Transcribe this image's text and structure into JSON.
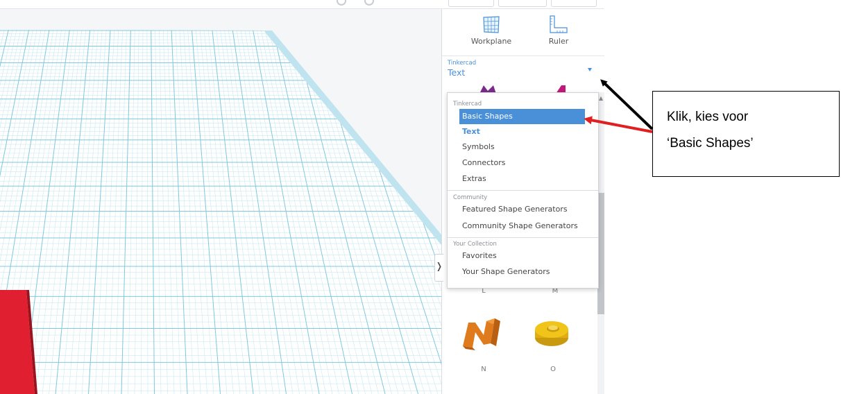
{
  "toolbar": {
    "workplane_label": "Workplane",
    "ruler_label": "Ruler",
    "workplane_icon": "workplane-icon",
    "ruler_icon": "ruler-icon"
  },
  "library_select": {
    "group": "Tinkercad",
    "value": "Text",
    "caret_icon": "chevron-down-icon"
  },
  "menu": {
    "sections": [
      {
        "title": "Tinkercad",
        "items": [
          "Basic Shapes",
          "Text",
          "Symbols",
          "Connectors",
          "Extras"
        ]
      },
      {
        "title": "Community",
        "items": [
          "Featured Shape Generators",
          "Community Shape Generators"
        ]
      },
      {
        "title": "Your Collection",
        "items": [
          "Favorites",
          "Your Shape Generators"
        ]
      }
    ],
    "highlighted": "Basic Shapes",
    "current": "Text"
  },
  "shapes": [
    {
      "label": "L"
    },
    {
      "label": "M"
    },
    {
      "label": "N",
      "color": "#e07b1d"
    },
    {
      "label": "O",
      "color": "#f0c419"
    }
  ],
  "annotation": {
    "line1": "Klik, kies voor",
    "line2": "‘Basic Shapes’"
  },
  "colors": {
    "accent": "#4a90d9",
    "grid_line": "#9fd6e6",
    "red_shape": "#e02030",
    "arrow_red": "#e02020",
    "arrow_black": "#000000"
  }
}
